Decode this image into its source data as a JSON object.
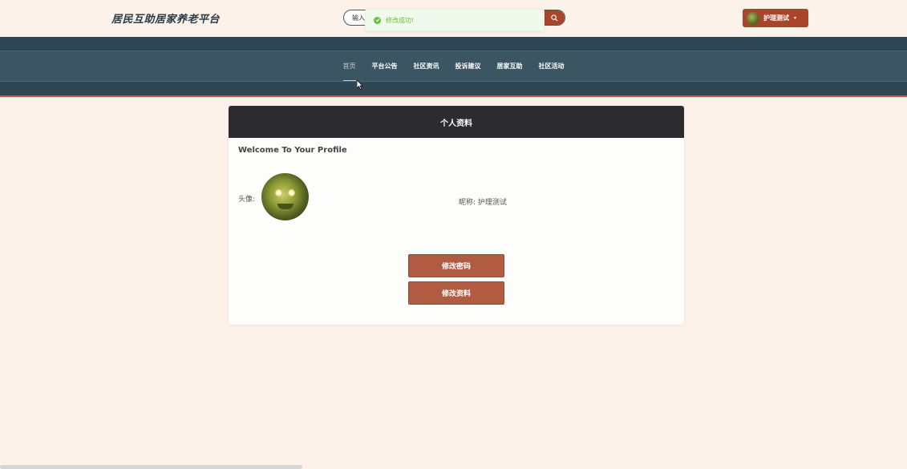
{
  "header": {
    "site_title": "居民互助居家养老平台",
    "search_placeholder": "输入",
    "search_icon": "search-icon",
    "user_name": "护理测试",
    "user_caret": "▾"
  },
  "toast": {
    "message": "修改成功!",
    "icon": "check-circle-icon",
    "color": "#67c23a"
  },
  "nav": {
    "items": [
      {
        "label": "首页",
        "active": true
      },
      {
        "label": "平台公告",
        "active": false
      },
      {
        "label": "社区资讯",
        "active": false
      },
      {
        "label": "投诉建议",
        "active": false
      },
      {
        "label": "居家互助",
        "active": false
      },
      {
        "label": "社区活动",
        "active": false
      }
    ]
  },
  "profile": {
    "header_title": "个人资料",
    "welcome": "Welcome To Your Profile",
    "avatar_label": "头像:",
    "nickname_text": "昵称: 护理测试",
    "change_password_label": "修改密码",
    "edit_profile_label": "修改资料"
  },
  "colors": {
    "accent": "#a9452a",
    "nav_bg": "#3b5563",
    "card_header": "#2c2c30",
    "page_bg": "#fcf2ea",
    "button": "#b25b43"
  }
}
